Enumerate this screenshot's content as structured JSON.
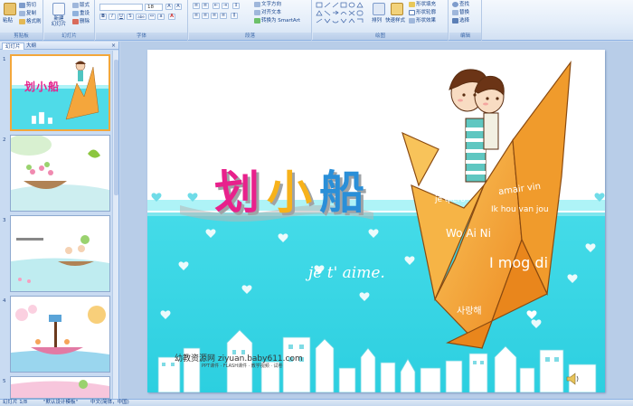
{
  "ribbon": {
    "clipboard": {
      "paste": "粘贴",
      "cut": "剪切",
      "copy": "复制",
      "format_painter": "格式刷",
      "label": "剪贴板"
    },
    "slides": {
      "new_slide": "新建\n幻灯片",
      "layout": "版式",
      "reset": "重设",
      "delete": "删除",
      "label": "幻灯片"
    },
    "font": {
      "size": "18",
      "bold": "B",
      "italic": "I",
      "underline": "U",
      "shadow": "S",
      "strike": "abe",
      "label": "字体"
    },
    "paragraph": {
      "text_direction": "文字方向",
      "align_text": "对齐文本",
      "smartart": "转换为 SmartArt",
      "label": "段落"
    },
    "drawing": {
      "arrange": "排列",
      "quick_styles": "快速样式",
      "shape_fill": "形状填充",
      "shape_outline": "形状轮廓",
      "shape_effects": "形状效果",
      "label": "绘图"
    },
    "editing": {
      "find": "查找",
      "replace": "替换",
      "select": "选择",
      "label": "编辑"
    }
  },
  "panel": {
    "tab_slides": "幻灯片",
    "tab_outline": "大纲",
    "numbers": [
      "1",
      "2",
      "3",
      "4",
      "5"
    ],
    "thumb1_title": "划小船"
  },
  "slide": {
    "title_chars": [
      "划",
      "小",
      "船"
    ],
    "title_colors": [
      "#e8218c",
      "#f7b21b",
      "#2a8fd8"
    ],
    "script_text": "je t' aime.",
    "love_words": [
      "amair vin",
      "je qiero",
      "Ik hou van jou",
      "Wo Ai Ni",
      "I mog di",
      "사랑해"
    ],
    "watermark_text": "幼教资源网 ziyuan.baby611.com",
    "watermark_sub": "PPT课件 · FLASH课件 · 教学视频 · 试卷",
    "colors": {
      "sky": "#aef3f7",
      "cyan": "#3fd7e4",
      "crane": "#f4a63c"
    }
  },
  "status": {
    "slide_info": "幻灯片 1/8",
    "theme": "\"默认设计模板\"",
    "language": "中文(简体，中国)"
  }
}
